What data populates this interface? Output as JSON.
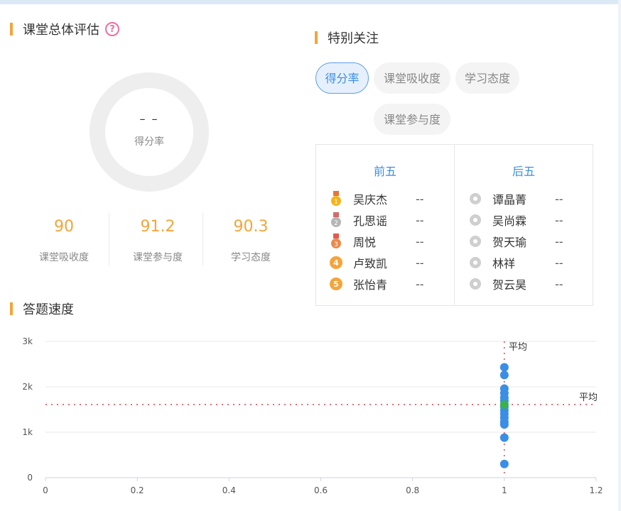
{
  "overall": {
    "title": "课堂总体评估",
    "help_icon": "question-circle-icon",
    "score_value": "– –",
    "score_label": "得分率",
    "metrics": [
      {
        "value": "90",
        "label": "课堂吸收度"
      },
      {
        "value": "91.2",
        "label": "课堂参与度"
      },
      {
        "value": "90.3",
        "label": "学习态度"
      }
    ]
  },
  "attention": {
    "title": "特别关注",
    "tabs": [
      "得分率",
      "课堂吸收度",
      "学习态度",
      "课堂参与度"
    ],
    "active_tab": 0,
    "top_label": "前五",
    "bottom_label": "后五",
    "top": [
      {
        "rank_icon": "gold-medal-icon",
        "name": "吴庆杰",
        "score": "--"
      },
      {
        "rank_icon": "silver-medal-icon",
        "name": "孔思谣",
        "score": "--"
      },
      {
        "rank_icon": "bronze-medal-icon",
        "name": "周悦",
        "score": "--"
      },
      {
        "rank_icon": "rank-badge-icon",
        "badge": "4",
        "name": "卢致凯",
        "score": "--"
      },
      {
        "rank_icon": "rank-badge-icon",
        "badge": "5",
        "name": "张怡青",
        "score": "--"
      }
    ],
    "bottom": [
      {
        "name": "谭晶菁",
        "score": "--"
      },
      {
        "name": "吴尚霖",
        "score": "--"
      },
      {
        "name": "贺天瑜",
        "score": "--"
      },
      {
        "name": "林祥",
        "score": "--"
      },
      {
        "name": "贺云昊",
        "score": "--"
      }
    ]
  },
  "speed": {
    "title": "答题速度"
  },
  "chart_data": {
    "type": "scatter",
    "title": "",
    "xlabel": "",
    "ylabel": "",
    "xlim": [
      0,
      1.2
    ],
    "ylim": [
      0,
      3000
    ],
    "x_ticks": [
      "0",
      "0.2",
      "0.4",
      "0.6",
      "0.8",
      "1",
      "1.2"
    ],
    "y_ticks": [
      "0",
      "1k",
      "2k",
      "3k"
    ],
    "grid": true,
    "points": [
      {
        "x": 1,
        "y": 2430
      },
      {
        "x": 1,
        "y": 2260
      },
      {
        "x": 1,
        "y": 1960
      },
      {
        "x": 1,
        "y": 1860
      },
      {
        "x": 1,
        "y": 1760
      },
      {
        "x": 1,
        "y": 1690
      },
      {
        "x": 1,
        "y": 1560
      },
      {
        "x": 1,
        "y": 1480
      },
      {
        "x": 1,
        "y": 1400
      },
      {
        "x": 1,
        "y": 1320
      },
      {
        "x": 1,
        "y": 1230
      },
      {
        "x": 1,
        "y": 1170
      },
      {
        "x": 1,
        "y": 880
      },
      {
        "x": 1,
        "y": 300
      }
    ],
    "highlight_point": {
      "x": 1,
      "y": 1610
    },
    "mean_x": 1,
    "mean_y": 1610,
    "mean_x_label": "平均",
    "mean_y_label": "平均",
    "point_color": "#3a8ee6",
    "highlight_color": "#37b24d",
    "mean_line_color": "#e0707a"
  }
}
